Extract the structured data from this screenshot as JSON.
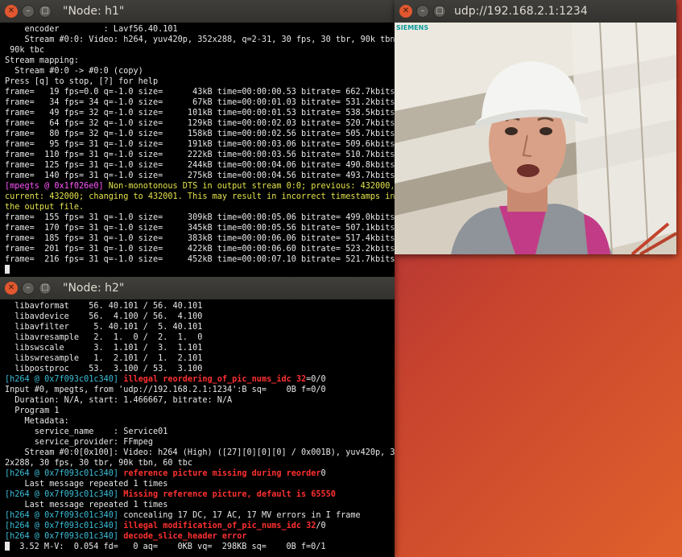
{
  "terminal_h1": {
    "title": "\"Node: h1\"",
    "lines": [
      {
        "t": "    encoder         : Lavf56.40.101"
      },
      {
        "t": "    Stream #0:0: Video: h264, yuv420p, 352x288, q=2-31, 30 fps, 30 tbr, 90k tbn,"
      },
      {
        "t": " 90k tbc"
      },
      {
        "t": "Stream mapping:"
      },
      {
        "t": "  Stream #0:0 -> #0:0 (copy)"
      },
      {
        "t": "Press [q] to stop, [?] for help"
      },
      {
        "t": "frame=   19 fps=0.0 q=-1.0 size=      43kB time=00:00:00.53 bitrate= 662.7kbits/"
      },
      {
        "t": "frame=   34 fps= 34 q=-1.0 size=      67kB time=00:00:01.03 bitrate= 531.2kbits/"
      },
      {
        "t": "frame=   49 fps= 32 q=-1.0 size=     101kB time=00:00:01.53 bitrate= 538.5kbits/"
      },
      {
        "t": "frame=   64 fps= 32 q=-1.0 size=     129kB time=00:00:02.03 bitrate= 520.7kbits/"
      },
      {
        "t": "frame=   80 fps= 32 q=-1.0 size=     158kB time=00:00:02.56 bitrate= 505.7kbits/"
      },
      {
        "t": "frame=   95 fps= 31 q=-1.0 size=     191kB time=00:00:03.06 bitrate= 509.6kbits/"
      },
      {
        "t": "frame=  110 fps= 31 q=-1.0 size=     222kB time=00:00:03.56 bitrate= 510.7kbits/"
      },
      {
        "t": "frame=  125 fps= 31 q=-1.0 size=     244kB time=00:00:04.06 bitrate= 490.8kbits/"
      },
      {
        "t": "frame=  140 fps= 31 q=-1.0 size=     275kB time=00:00:04.56 bitrate= 493.7kbits/"
      },
      {
        "t": "[mpegts @ 0x1f026e0]",
        "c": "magenta",
        "rest": " Non-monotonous DTS in output stream 0:0; previous: 432000,",
        "rc": "yellow"
      },
      {
        "t": "current: 432000; changing to 432001. This may result in incorrect timestamps in",
        "c": "yellow"
      },
      {
        "t": "the output file.",
        "c": "yellow"
      },
      {
        "t": "frame=  155 fps= 31 q=-1.0 size=     309kB time=00:00:05.06 bitrate= 499.0kbits/"
      },
      {
        "t": "frame=  170 fps= 31 q=-1.0 size=     345kB time=00:00:05.56 bitrate= 507.1kbits/"
      },
      {
        "t": "frame=  185 fps= 31 q=-1.0 size=     383kB time=00:00:06.06 bitrate= 517.4kbits/"
      },
      {
        "t": "frame=  201 fps= 31 q=-1.0 size=     422kB time=00:00:06.60 bitrate= 523.2kbits/"
      },
      {
        "t": "frame=  216 fps= 31 q=-1.0 size=     452kB time=00:00:07.10 bitrate= 521.7kbits/"
      }
    ]
  },
  "terminal_h2": {
    "title": "\"Node: h2\"",
    "lines": [
      {
        "t": "  libavformat    56. 40.101 / 56. 40.101"
      },
      {
        "t": "  libavdevice    56.  4.100 / 56.  4.100"
      },
      {
        "t": "  libavfilter     5. 40.101 /  5. 40.101"
      },
      {
        "t": "  libavresample   2.  1.  0 /  2.  1.  0"
      },
      {
        "t": "  libswscale      3.  1.101 /  3.  1.101"
      },
      {
        "t": "  libswresample   1.  2.101 /  1.  2.101"
      },
      {
        "t": "  libpostproc    53.  3.100 / 53.  3.100"
      },
      {
        "t": "[h264 @ 0x7f093c01c340] ",
        "c": "cyan",
        "rest": "illegal reordering_of_pic_nums_idc 32",
        "rc": "red",
        "tail": "=0/0"
      },
      {
        "t": "Input #0, mpegts, from 'udp://192.168.2.1:1234':B sq=    0B f=0/0"
      },
      {
        "t": "  Duration: N/A, start: 1.466667, bitrate: N/A"
      },
      {
        "t": "  Program 1"
      },
      {
        "t": "    Metadata:"
      },
      {
        "t": "      service_name    : Service01"
      },
      {
        "t": "      service_provider: FFmpeg"
      },
      {
        "t": "    Stream #0:0[0x100]: Video: h264 (High) ([27][0][0][0] / 0x001B), yuv420p, 35"
      },
      {
        "t": "2x288, 30 fps, 30 tbr, 90k tbn, 60 tbc"
      },
      {
        "t": "[h264 @ 0x7f093c01c340] ",
        "c": "cyan",
        "rest": "reference picture missing during reorder",
        "rc": "red",
        "tail": "0"
      },
      {
        "t": "    Last message repeated 1 times"
      },
      {
        "t": "[h264 @ 0x7f093c01c340] ",
        "c": "cyan",
        "rest": "Missing reference picture, default is 65550",
        "rc": "red"
      },
      {
        "t": "    Last message repeated 1 times"
      },
      {
        "t": "[h264 @ 0x7f093c01c340] ",
        "c": "cyan",
        "rest": "concealing 17 DC, 17 AC, 17 MV errors in I frame"
      },
      {
        "t": "[h264 @ 0x7f093c01c340] ",
        "c": "cyan",
        "rest": "illegal modification_of_pic_nums_idc 32",
        "rc": "red",
        "tail": "/0"
      },
      {
        "t": "[h264 @ 0x7f093c01c340] ",
        "c": "cyan",
        "rest": "decode_slice_header error",
        "rc": "red"
      },
      {
        "t": "  3.52 M-V:  0.054 fd=   0 aq=    0KB vq=  298KB sq=    0B f=0/1",
        "cursor_first": true
      }
    ]
  },
  "video_window": {
    "title": "udp://192.168.2.1:1234",
    "logo": "SIEMENS"
  },
  "colors": {
    "accent_close": "#e2572f",
    "titlebar": "#3a3935",
    "term_bg": "#000000",
    "term_fg": "#e8e8e8",
    "warn_yellow": "#e4e44c",
    "tag_magenta": "#ff55ff",
    "tag_cyan": "#3bbfd9",
    "error_red": "#ff3030"
  }
}
